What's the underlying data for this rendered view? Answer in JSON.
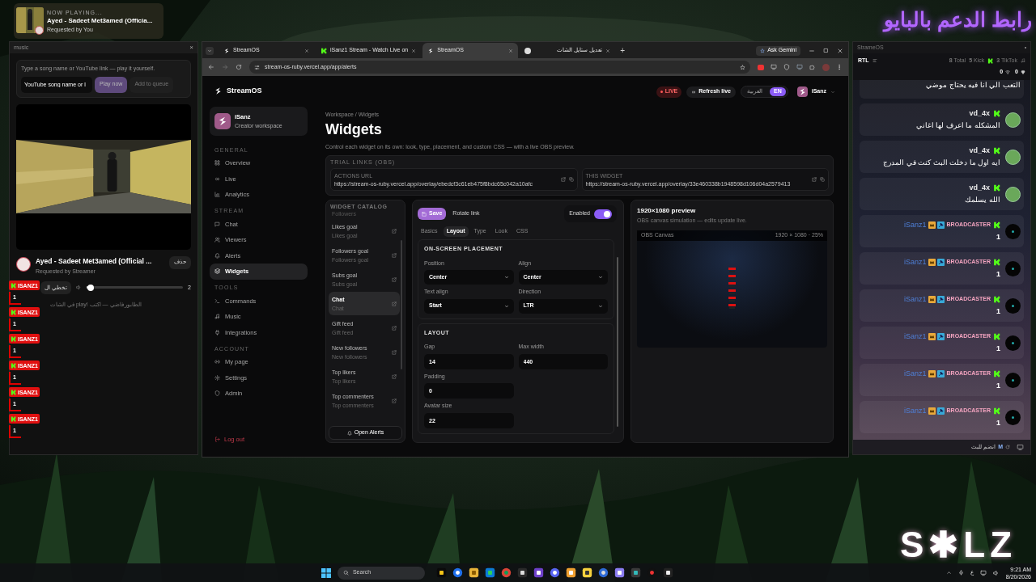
{
  "overlay_banner": {
    "text": "رابط الدعم بالبايو"
  },
  "now_playing": {
    "label": "NOW PLAYING...",
    "title": "Ayed - Sadeet Met3amed (Officia...",
    "requester": "Requested by You"
  },
  "music_window": {
    "title": "music",
    "close": "×",
    "hint": "Type a song name or YouTube link — play it yourself.",
    "input_value": "YouTube song name or l",
    "play_button": "Play now",
    "queue_button": "Add to queue",
    "song_title": "Ayed - Sadeet Met3amed (Official ...",
    "song_requester": "Requested by Streamer",
    "remove_button": "حذف",
    "skip_button": "تخطي ال",
    "volume": {
      "level": 0.02,
      "reading": "2"
    },
    "queue_empty": "الطابور فاضي — اكتب !play في الشات"
  },
  "overlay_chat": [
    {
      "name": "ISANZ1",
      "text": "1"
    },
    {
      "name": "ISANZ1",
      "text": "1"
    },
    {
      "name": "ISANZ1",
      "text": "1"
    },
    {
      "name": "ISANZ1",
      "text": "1"
    },
    {
      "name": "ISANZ1",
      "text": "1"
    },
    {
      "name": "ISANZ1",
      "text": "1"
    }
  ],
  "browser": {
    "tabs": [
      {
        "title": "StreamOS",
        "kind": "app",
        "selected": false
      },
      {
        "title": "iSanz1 Stream - Watch Live on",
        "kind": "kick",
        "selected": false
      },
      {
        "title": "StreamOS",
        "kind": "app",
        "selected": true
      },
      {
        "title": "تعديل ستايل الشات",
        "kind": "page",
        "selected": false
      }
    ],
    "new_tab": "+",
    "gemini": "Ask Gemini",
    "url": "stream-os-ruby.vercel.app/app/alerts"
  },
  "app": {
    "brand": "StreamOS",
    "live": "LIVE",
    "refresh": "Refresh live",
    "languages": [
      {
        "label": "العربية",
        "selected": false
      },
      {
        "label": "EN",
        "selected": true
      }
    ],
    "user": "iSanz",
    "profile": {
      "name": "iSanz",
      "role": "Creator workspace"
    },
    "nav": [
      {
        "heading": "GENERAL",
        "items": [
          {
            "label": "Overview",
            "selected": false
          },
          {
            "label": "Live",
            "selected": false
          },
          {
            "label": "Analytics",
            "selected": false
          }
        ]
      },
      {
        "heading": "STREAM",
        "items": [
          {
            "label": "Chat",
            "selected": false
          },
          {
            "label": "Viewers",
            "selected": false
          },
          {
            "label": "Alerts",
            "selected": false
          },
          {
            "label": "Widgets",
            "selected": true
          }
        ]
      },
      {
        "heading": "TOOLS",
        "items": [
          {
            "label": "Commands",
            "selected": false
          },
          {
            "label": "Music",
            "selected": false
          },
          {
            "label": "Integrations",
            "selected": false
          }
        ]
      },
      {
        "heading": "ACCOUNT",
        "items": [
          {
            "label": "My page",
            "selected": false
          },
          {
            "label": "Settings",
            "selected": false
          },
          {
            "label": "Admin",
            "selected": false
          }
        ]
      }
    ],
    "logout": "Log out",
    "breadcrumb": "Workspace / Widgets",
    "title": "Widgets",
    "description": "Control each widget on its own: look, type, placement, and custom CSS — with a live OBS preview.",
    "trial_links": {
      "heading": "TRIAL LINKS (OBS)",
      "links": [
        {
          "label": "ACTIONS URL",
          "url": "https://stream-os-ruby.vercel.app/overlay/ebedcf3c61eb475f8bdc65c042a10afc"
        },
        {
          "label": "THIS WIDGET",
          "url": "https://stream-os-ruby.vercel.app/overlay/33e460338b1948598d106d04a2579413"
        }
      ]
    },
    "catalog": {
      "heading": "WIDGET CATALOG",
      "partial_item": "Followers",
      "items": [
        {
          "title": "Likes goal",
          "subtitle": "Likes goal",
          "selected": false
        },
        {
          "title": "Followers goal",
          "subtitle": "Followers goal",
          "selected": false
        },
        {
          "title": "Subs goal",
          "subtitle": "Subs goal",
          "selected": false
        },
        {
          "title": "Chat",
          "subtitle": "Chat",
          "selected": true
        },
        {
          "title": "Gift feed",
          "subtitle": "Gift feed",
          "selected": false
        },
        {
          "title": "New followers",
          "subtitle": "New followers",
          "selected": false
        },
        {
          "title": "Top likers",
          "subtitle": "Top likers",
          "selected": false
        },
        {
          "title": "Top commenters",
          "subtitle": "Top commenters",
          "selected": false
        }
      ],
      "button": "Open Alerts"
    },
    "editor": {
      "save": "Save",
      "rotate": "Rotate link",
      "enabled_label": "Enabled",
      "enabled": true,
      "tabs": [
        {
          "label": "Basics",
          "selected": false
        },
        {
          "label": "Layout",
          "selected": true
        },
        {
          "label": "Type",
          "selected": false
        },
        {
          "label": "Look",
          "selected": false
        },
        {
          "label": "CSS",
          "selected": false
        }
      ],
      "sections": [
        {
          "heading": "ON-SCREEN PLACEMENT",
          "kind": "select",
          "fields": [
            {
              "label": "Position",
              "value": "Center"
            },
            {
              "label": "Align",
              "value": "Center"
            },
            {
              "label": "Text align",
              "value": "Start"
            },
            {
              "label": "Direction",
              "value": "LTR"
            }
          ]
        },
        {
          "heading": "LAYOUT",
          "kind": "number",
          "fields": [
            {
              "label": "Gap",
              "value": "14"
            },
            {
              "label": "Max width",
              "value": "440"
            },
            {
              "label": "Padding",
              "value": "0"
            },
            {
              "label": "Avatar size",
              "value": "22"
            }
          ]
        }
      ]
    },
    "preview": {
      "title": "1920×1080 preview",
      "subtitle": "OBS canvas simulation — edits update live.",
      "canvas_label": "OBS Canvas",
      "canvas_size": "1920 × 1080 · 25%"
    }
  },
  "chat_window": {
    "title": "StrameOS",
    "direction": "RTL",
    "stats": [
      "**8** Total",
      "**5** Kick",
      "**3** TikTok"
    ],
    "gifts": "0",
    "likes": "0",
    "messages": [
      {
        "kind": "partial",
        "text": "التعب الي انا فيه يحتاج موضي"
      },
      {
        "kind": "viewer",
        "name": "vd_4x",
        "text": "المشكله ما اعرف لها اغاني"
      },
      {
        "kind": "viewer",
        "name": "vd_4x",
        "text": "ايه اول ما دخلت البث كنت في المدرج"
      },
      {
        "kind": "viewer",
        "name": "vd_4x",
        "text": "الله يسلمك"
      },
      {
        "kind": "broadcaster",
        "name": "iSanz1",
        "role": "BROADCASTER",
        "text": "1"
      },
      {
        "kind": "broadcaster",
        "name": "iSanz1",
        "role": "BROADCASTER",
        "text": "1"
      },
      {
        "kind": "broadcaster",
        "name": "iSanz1",
        "role": "BROADCASTER",
        "text": "1"
      },
      {
        "kind": "broadcaster",
        "name": "iSanz1",
        "role": "BROADCASTER",
        "text": "1"
      },
      {
        "kind": "broadcaster",
        "name": "iSanz1",
        "role": "BROADCASTER",
        "text": "1"
      },
      {
        "kind": "broadcaster",
        "name": "iSanz1",
        "role": "BROADCASTER",
        "text": "1"
      }
    ],
    "footer_key": "M",
    "footer_text": "انضم للبث"
  },
  "taskbar": {
    "search": "Search",
    "language": "ع",
    "time": "9:21 AM",
    "date": "8/20/2026"
  },
  "logo": {
    "text": "S✱LZ"
  }
}
